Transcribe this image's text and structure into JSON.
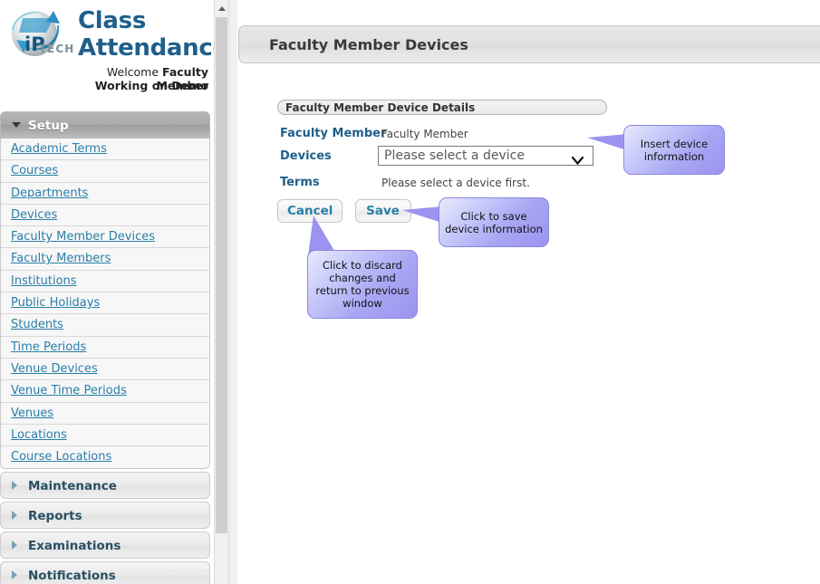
{
  "brand": {
    "logo_icon": "iptech-globe-logo",
    "title_line1": "Class",
    "title_line2": "Attendance",
    "welcome_prefix": "Welcome ",
    "welcome_user": "Faculty Member",
    "working_on": "Working on Demo"
  },
  "sidebar": {
    "groups": [
      {
        "label": "Setup",
        "expanded": true,
        "icon": "chevron-down-icon",
        "items": [
          {
            "label": "Academic Terms"
          },
          {
            "label": "Courses"
          },
          {
            "label": "Departments"
          },
          {
            "label": "Devices"
          },
          {
            "label": "Faculty Member Devices"
          },
          {
            "label": "Faculty Members"
          },
          {
            "label": "Institutions"
          },
          {
            "label": "Public Holidays"
          },
          {
            "label": "Students"
          },
          {
            "label": "Time Periods"
          },
          {
            "label": "Venue Devices"
          },
          {
            "label": "Venue Time Periods"
          },
          {
            "label": "Venues"
          },
          {
            "label": "Locations"
          },
          {
            "label": "Course Locations"
          }
        ]
      },
      {
        "label": "Maintenance",
        "expanded": false,
        "icon": "chevron-right-icon",
        "items": []
      },
      {
        "label": "Reports",
        "expanded": false,
        "icon": "chevron-right-icon",
        "items": []
      },
      {
        "label": "Examinations",
        "expanded": false,
        "icon": "chevron-right-icon",
        "items": []
      },
      {
        "label": "Notifications",
        "expanded": false,
        "icon": "chevron-right-icon",
        "items": []
      }
    ]
  },
  "scrollbar": {
    "up_arrow_icon": "chevron-up-icon"
  },
  "header": {
    "title": "Faculty Member Devices"
  },
  "form": {
    "legend": "Faculty Member Device Details",
    "faculty_member_label": "Faculty Member",
    "faculty_member_value": "Faculty Member",
    "devices_label": "Devices",
    "devices_selected": "Please select a device",
    "devices_options": [
      "Please select a device"
    ],
    "devices_chevron_icon": "chevron-down-icon",
    "terms_label": "Terms",
    "terms_value": "Please select a device first."
  },
  "buttons": {
    "cancel": "Cancel",
    "save": "Save"
  },
  "callouts": {
    "insert": "Insert device information",
    "save": "Click to save device information",
    "cancel": "Click to discard changes and return to previous window"
  },
  "colors": {
    "brand_blue": "#1f5f8b",
    "link_blue": "#2a7fa8",
    "callout_fill": "#9b93ef",
    "callout_border": "#8e84e0"
  }
}
